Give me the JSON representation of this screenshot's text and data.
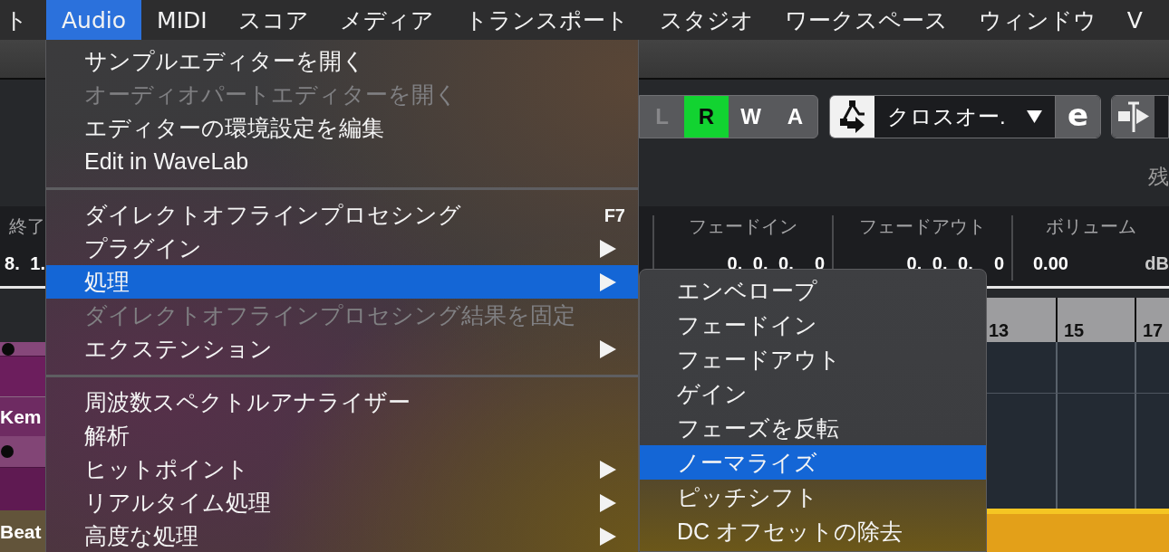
{
  "menu_bar": {
    "items": [
      {
        "label": "ト",
        "selected": false
      },
      {
        "label": "Audio",
        "selected": true
      },
      {
        "label": "MIDI",
        "selected": false
      },
      {
        "label": "スコア",
        "selected": false
      },
      {
        "label": "メディア",
        "selected": false
      },
      {
        "label": "トランスポート",
        "selected": false
      },
      {
        "label": "スタジオ",
        "selected": false
      },
      {
        "label": "ワークスペース",
        "selected": false
      },
      {
        "label": "ウィンドウ",
        "selected": false
      },
      {
        "label": "V",
        "selected": false
      }
    ]
  },
  "audio_menu": {
    "items": [
      {
        "kind": "item",
        "label": "サンプルエディターを開く",
        "disabled": false,
        "selected": false,
        "submenu": false
      },
      {
        "kind": "item",
        "label": "オーディオパートエディターを開く",
        "disabled": true,
        "selected": false,
        "submenu": false
      },
      {
        "kind": "item",
        "label": "エディターの環境設定を編集",
        "disabled": false,
        "selected": false,
        "submenu": false
      },
      {
        "kind": "item",
        "label": "Edit in WaveLab",
        "disabled": false,
        "selected": false,
        "submenu": false
      },
      {
        "kind": "separator"
      },
      {
        "kind": "item",
        "label": "ダイレクトオフラインプロセシング",
        "shortcut": "F7",
        "disabled": false,
        "selected": false,
        "submenu": false
      },
      {
        "kind": "item",
        "label": "プラグイン",
        "disabled": false,
        "selected": false,
        "submenu": true
      },
      {
        "kind": "item",
        "label": "処理",
        "disabled": false,
        "selected": true,
        "submenu": true
      },
      {
        "kind": "item",
        "label": "ダイレクトオフラインプロセシング結果を固定",
        "disabled": true,
        "selected": false,
        "submenu": false
      },
      {
        "kind": "item",
        "label": "エクステンション",
        "disabled": false,
        "selected": false,
        "submenu": true
      },
      {
        "kind": "separator"
      },
      {
        "kind": "item",
        "label": "周波数スペクトルアナライザー",
        "disabled": false,
        "selected": false,
        "submenu": false
      },
      {
        "kind": "item",
        "label": "解析",
        "disabled": false,
        "selected": false,
        "submenu": false
      },
      {
        "kind": "item",
        "label": "ヒットポイント",
        "disabled": false,
        "selected": false,
        "submenu": true
      },
      {
        "kind": "item",
        "label": "リアルタイム処理",
        "disabled": false,
        "selected": false,
        "submenu": true
      },
      {
        "kind": "item",
        "label": "高度な処理",
        "disabled": false,
        "selected": false,
        "submenu": true
      }
    ]
  },
  "processing_submenu": {
    "items": [
      {
        "label": "エンベロープ",
        "selected": false
      },
      {
        "label": "フェードイン",
        "selected": false
      },
      {
        "label": "フェードアウト",
        "selected": false
      },
      {
        "label": "ゲイン",
        "selected": false
      },
      {
        "label": "フェーズを反転",
        "selected": false
      },
      {
        "label": "ノーマライズ",
        "selected": true
      },
      {
        "label": "ピッチシフト",
        "selected": false
      },
      {
        "label": "DC オフセットの除去",
        "selected": false
      }
    ]
  },
  "toolbar": {
    "automation_buttons": [
      {
        "label": "L",
        "on": false,
        "disabled": true
      },
      {
        "label": "R",
        "on": true,
        "disabled": false
      },
      {
        "label": "W",
        "on": false,
        "disabled": false
      },
      {
        "label": "A",
        "on": false,
        "disabled": false
      }
    ],
    "crossfade_selector": {
      "value": "クロスオー."
    },
    "edit_button": {
      "label": "e"
    },
    "side_label": "残"
  },
  "info_line": {
    "fields": [
      {
        "header": "終了",
        "value": "8. 1."
      },
      {
        "header": "フェードイン",
        "value": "0. 0. 0.  0"
      },
      {
        "header": "フェードアウト",
        "value": "0. 0. 0.  0"
      },
      {
        "header": "ボリューム",
        "value": "0.00",
        "unit": "dB"
      }
    ]
  },
  "tracks": [
    {
      "name": "Kem"
    },
    {
      "name": "Beat"
    }
  ],
  "ruler": {
    "bar_numbers": [
      "13",
      "15",
      "17"
    ]
  }
}
